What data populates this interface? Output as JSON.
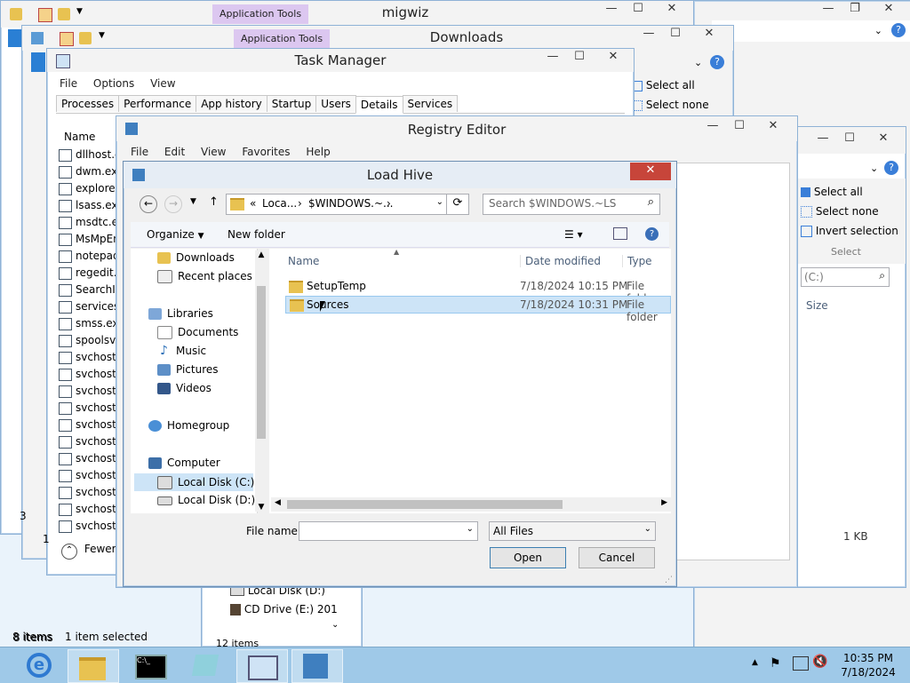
{
  "desktop": {
    "migwiz": {
      "title": "migwiz",
      "app_tools": "Application Tools"
    },
    "downloads": {
      "title": "Downloads",
      "app_tools": "Application Tools",
      "ribbon": {
        "select_all": "Select all",
        "select_none": "Select none"
      }
    },
    "explorer_right": {
      "ribbon": {
        "select_all": "Select all",
        "select_none": "Select none",
        "invert": "Invert selection",
        "group": "Select"
      },
      "search_placeholder": "(C:)",
      "size_col": "Size",
      "size_val": "1 KB"
    },
    "explorer_bottom": {
      "items": [
        {
          "label": "Local Disk (D:)",
          "icon": "drive-icon"
        },
        {
          "label": "CD Drive (E:) 201",
          "icon": "cd-drive-icon"
        }
      ],
      "status": "12 items"
    },
    "explorer_left_status": {
      "items": "8 items",
      "selected": "1 item selected"
    },
    "left_edge_digits": [
      "3",
      "1"
    ]
  },
  "task_manager": {
    "title": "Task Manager",
    "menu": [
      "File",
      "Options",
      "View"
    ],
    "tabs": [
      "Processes",
      "Performance",
      "App history",
      "Startup",
      "Users",
      "Details",
      "Services"
    ],
    "active_tab": "Details",
    "column": "Name",
    "processes": [
      "dllhost.ex",
      "dwm.exe",
      "explorer.e",
      "lsass.exe",
      "msdtc.exe",
      "MsMpEn",
      "notepad.",
      "regedit.e",
      "SearchIn",
      "services.e",
      "smss.exe",
      "spoolsv.e",
      "svchost.e",
      "svchost.e",
      "svchost.e",
      "svchost.e",
      "svchost.e",
      "svchost.e",
      "svchost.e",
      "svchost.e",
      "svchost.e",
      "svchost.e",
      "svchost.e"
    ],
    "fewer_details": "Fewer"
  },
  "registry_editor": {
    "title": "Registry Editor",
    "menu": [
      "File",
      "Edit",
      "View",
      "Favorites",
      "Help"
    ]
  },
  "load_hive": {
    "title": "Load Hive",
    "breadcrumb": {
      "prefix": "«",
      "part1": "Loca...",
      "part2": "$WINDOWS.~..."
    },
    "search_placeholder": "Search $WINDOWS.~LS",
    "toolbar": {
      "organize": "Organize",
      "new_folder": "New folder"
    },
    "nav": {
      "favorites": [
        {
          "label": "Downloads",
          "icon": "downloads-folder-icon"
        },
        {
          "label": "Recent places",
          "icon": "recent-places-icon"
        }
      ],
      "libraries": {
        "label": "Libraries",
        "items": [
          {
            "label": "Documents",
            "icon": "documents-icon"
          },
          {
            "label": "Music",
            "icon": "music-icon"
          },
          {
            "label": "Pictures",
            "icon": "pictures-icon"
          },
          {
            "label": "Videos",
            "icon": "videos-icon"
          }
        ]
      },
      "homegroup": "Homegroup",
      "computer": {
        "label": "Computer",
        "drives": [
          {
            "label": "Local Disk (C:)",
            "selected": true
          },
          {
            "label": "Local Disk (D:)",
            "selected": false
          }
        ]
      }
    },
    "columns": {
      "name": "Name",
      "date": "Date modified",
      "type": "Type"
    },
    "files": [
      {
        "name": "SetupTemp",
        "date": "7/18/2024 10:15 PM",
        "type": "File folder",
        "selected": false
      },
      {
        "name": "Sources",
        "date": "7/18/2024 10:31 PM",
        "type": "File folder",
        "selected": true
      }
    ],
    "filename_label": "File name:",
    "filename_value": "",
    "filter": "All Files",
    "open": "Open",
    "cancel": "Cancel"
  },
  "taskbar": {
    "apps": [
      {
        "name": "internet-explorer-icon",
        "active": false
      },
      {
        "name": "file-explorer-icon",
        "active": true
      },
      {
        "name": "command-prompt-icon",
        "active": false
      },
      {
        "name": "migwiz-icon",
        "active": false
      },
      {
        "name": "task-manager-icon",
        "active": true
      },
      {
        "name": "registry-editor-icon",
        "active": true
      }
    ],
    "time": "10:35 PM",
    "date": "7/18/2024"
  },
  "colors": {
    "accent": "#3399ff",
    "close_red": "#c7453a",
    "selection": "#cde4f7",
    "app_tools": "#dcc7f0",
    "taskbar": "#9fc9e8"
  }
}
